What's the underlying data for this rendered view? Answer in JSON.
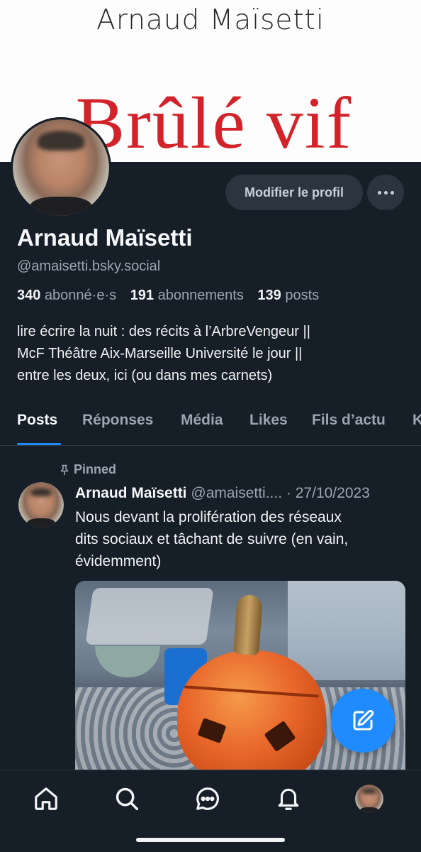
{
  "banner": {
    "author": "Arnaud Maïsetti",
    "title": "Brûlé vif"
  },
  "profile": {
    "edit_button": "Modifier le profil",
    "more_icon": "ellipsis-icon",
    "display_name": "Arnaud Maïsetti",
    "handle": "@amaisetti.bsky.social",
    "followers_count": "340",
    "followers_label": "abonné·e·s",
    "following_count": "191",
    "following_label": "abonnements",
    "posts_count": "139",
    "posts_label": "posts",
    "bio": [
      "lire écrire la nuit : des récits à l’ArbreVengeur ||",
      "McF Théâtre Aix-Marseille Université le jour ||",
      "entre les deux, ici (ou dans mes carnets)"
    ]
  },
  "tabs": [
    {
      "label": "Posts",
      "active": true
    },
    {
      "label": "Réponses",
      "active": false
    },
    {
      "label": "Média",
      "active": false
    },
    {
      "label": "Likes",
      "active": false
    },
    {
      "label": "Fils d’actu",
      "active": false
    },
    {
      "label": "K",
      "active": false
    }
  ],
  "post": {
    "pinned_label": "Pinned",
    "author_name": "Arnaud Maïsetti",
    "author_handle": "@amaisetti....",
    "date_sep": "·",
    "date": "27/10/2023",
    "text": [
      "Nous devant la prolifération des réseaux",
      "dits sociaux et tâchant de suivre (en vain,",
      "évidemment)"
    ]
  },
  "fab": {
    "icon": "compose-icon"
  },
  "bottom_nav": {
    "items": [
      "home-icon",
      "search-icon",
      "chat-icon",
      "bell-icon",
      "profile-avatar"
    ]
  },
  "colors": {
    "background": "#161e27",
    "accent": "#208bfe",
    "banner_title": "#d2232a",
    "muted_text": "#9aa6b2"
  }
}
